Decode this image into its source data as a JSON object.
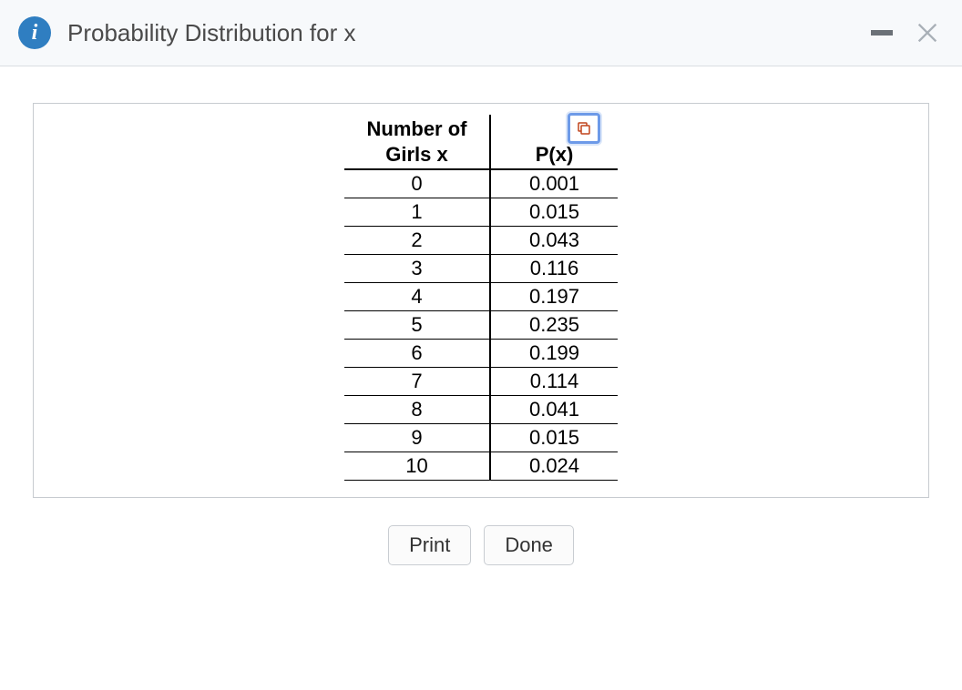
{
  "header": {
    "title": "Probability Distribution for x"
  },
  "table": {
    "headers": {
      "col1": "Number of\nGirls x",
      "col2": "P(x)"
    },
    "rows": [
      {
        "x": "0",
        "p": "0.001"
      },
      {
        "x": "1",
        "p": "0.015"
      },
      {
        "x": "2",
        "p": "0.043"
      },
      {
        "x": "3",
        "p": "0.116"
      },
      {
        "x": "4",
        "p": "0.197"
      },
      {
        "x": "5",
        "p": "0.235"
      },
      {
        "x": "6",
        "p": "0.199"
      },
      {
        "x": "7",
        "p": "0.114"
      },
      {
        "x": "8",
        "p": "0.041"
      },
      {
        "x": "9",
        "p": "0.015"
      },
      {
        "x": "10",
        "p": "0.024"
      }
    ]
  },
  "buttons": {
    "print": "Print",
    "done": "Done"
  }
}
